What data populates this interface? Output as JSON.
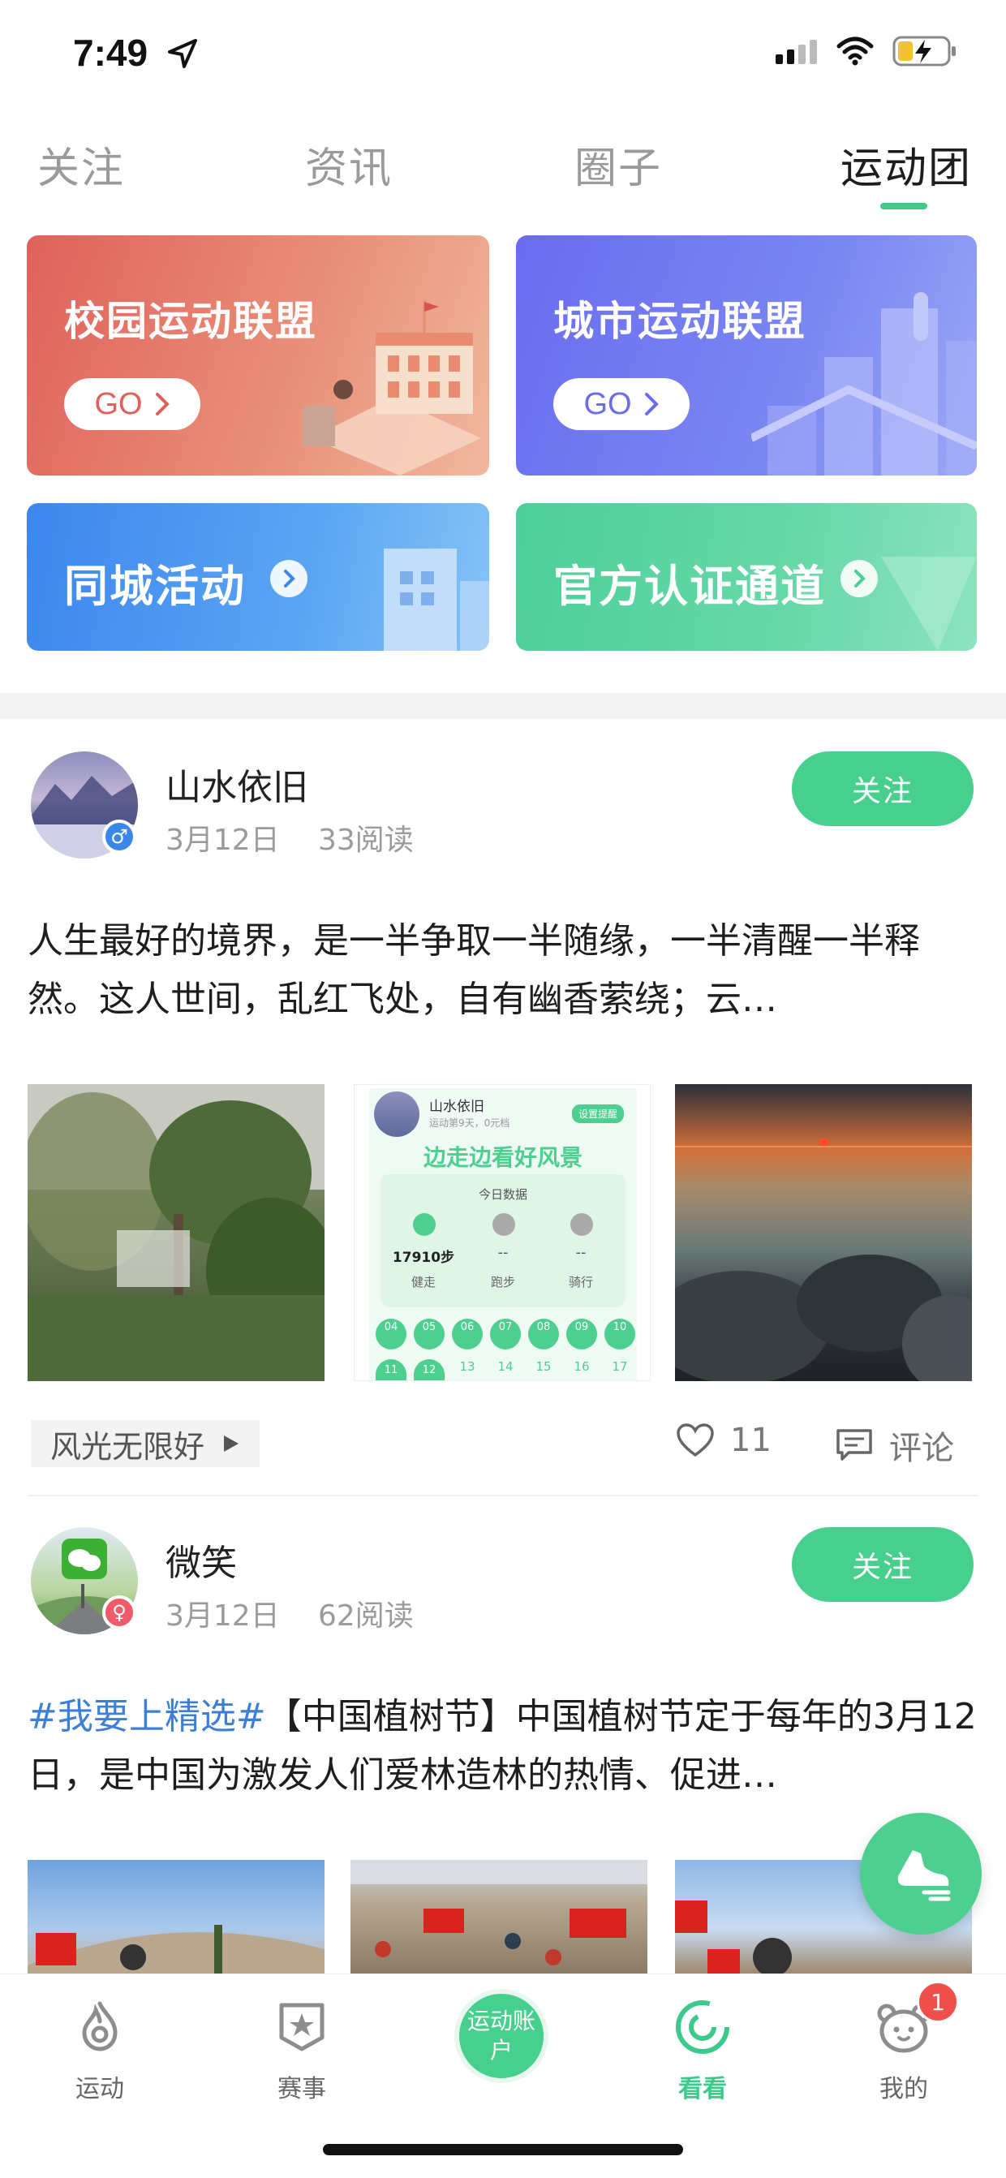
{
  "status": {
    "time": "7:49"
  },
  "tabs": [
    {
      "label": "关注"
    },
    {
      "label": "资讯"
    },
    {
      "label": "圈子"
    },
    {
      "label": "运动团"
    }
  ],
  "banners": {
    "campus": {
      "title": "校园运动联盟",
      "go": "GO"
    },
    "city": {
      "title": "城市运动联盟",
      "go": "GO"
    },
    "local": {
      "title": "同城活动"
    },
    "official": {
      "title": "官方认证通道"
    }
  },
  "posts": [
    {
      "username": "山水依旧",
      "date": "3月12日",
      "reads": "33阅读",
      "follow": "关注",
      "text": "人生最好的境界，是一半争取一半随缘，一半清醒一半释然。这人世间，乱红飞处，自有幽香萦绕；云…",
      "tag": "风光无限好",
      "likes": "11",
      "comment": "评论",
      "screenshot": {
        "name": "山水依旧",
        "sub": "运动第9天，0元档",
        "remind": "设置提醒",
        "slogan": "边走边看好风景",
        "today": "今日数据",
        "steps": "17910步",
        "walk": "健走",
        "run": "跑步",
        "ride": "骑行",
        "dash": "--",
        "days1": [
          "04",
          "05",
          "06",
          "07",
          "08",
          "09",
          "10"
        ],
        "days2": [
          "11",
          "12",
          "13",
          "14",
          "15",
          "16",
          "17"
        ]
      }
    },
    {
      "username": "微笑",
      "date": "3月12日",
      "reads": "62阅读",
      "follow": "关注",
      "hashtag": "#我要上精选#",
      "text": "【中国植树节】中国植树节定于每年的3月12日，是中国为激发人们爱林造林的热情、促进…"
    }
  ],
  "nav": [
    {
      "label": "运动"
    },
    {
      "label": "赛事"
    },
    {
      "label": "运动账户"
    },
    {
      "label": "看看"
    },
    {
      "label": "我的",
      "badge": "1"
    }
  ],
  "colors": {
    "accent": "#46cf8d",
    "hashtag": "#3c7ed8",
    "badge": "#f0504c"
  }
}
